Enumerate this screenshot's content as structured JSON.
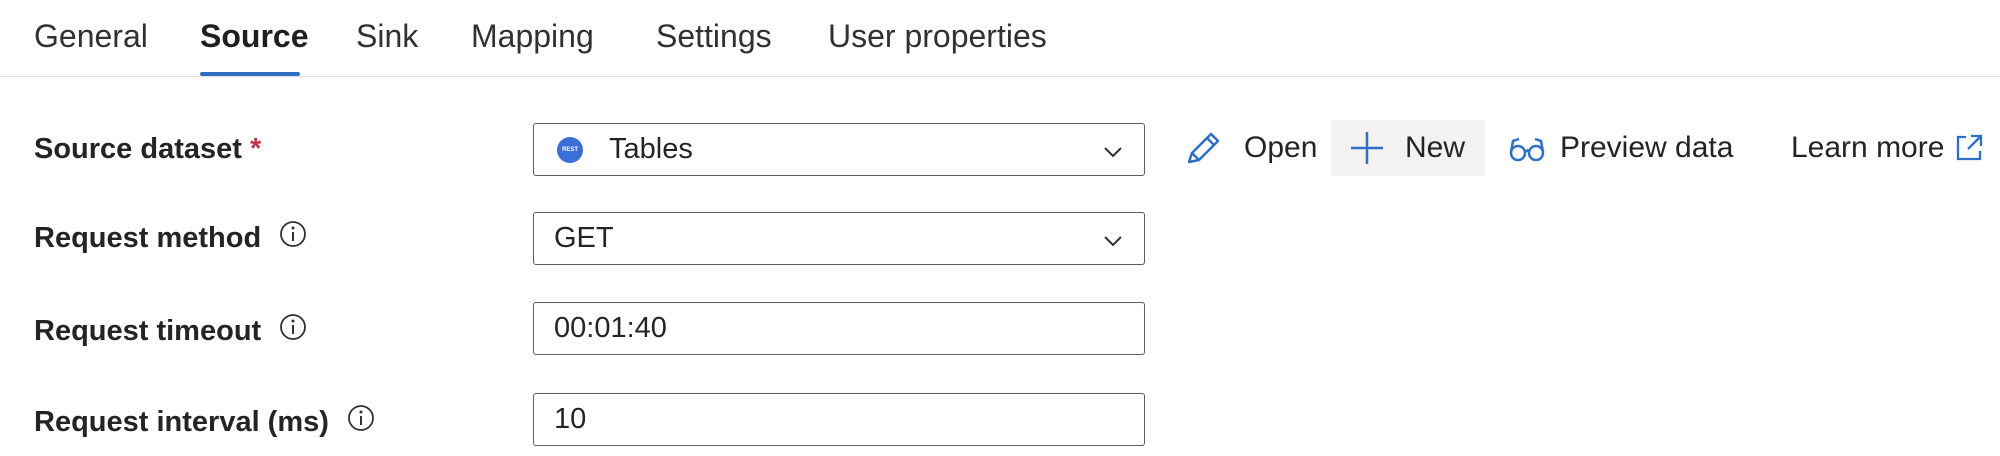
{
  "tabs": [
    {
      "label": "General"
    },
    {
      "label": "Source"
    },
    {
      "label": "Sink"
    },
    {
      "label": "Mapping"
    },
    {
      "label": "Settings"
    },
    {
      "label": "User properties"
    }
  ],
  "active_tab": "Source",
  "source_dataset": {
    "label": "Source dataset",
    "required_marker": "*",
    "icon_text": "REST",
    "value": "Tables"
  },
  "actions": {
    "open_label": "Open",
    "new_label": "New",
    "preview_label": "Preview data",
    "learn_more_label": "Learn more"
  },
  "request_method": {
    "label": "Request method",
    "value": "GET"
  },
  "request_timeout": {
    "label": "Request timeout",
    "value": "00:01:40"
  },
  "request_interval": {
    "label": "Request interval (ms)",
    "value": "10"
  },
  "colors": {
    "accent": "#2f6fc6",
    "required": "#c4314b",
    "rest_icon": "#3a6fd8"
  }
}
